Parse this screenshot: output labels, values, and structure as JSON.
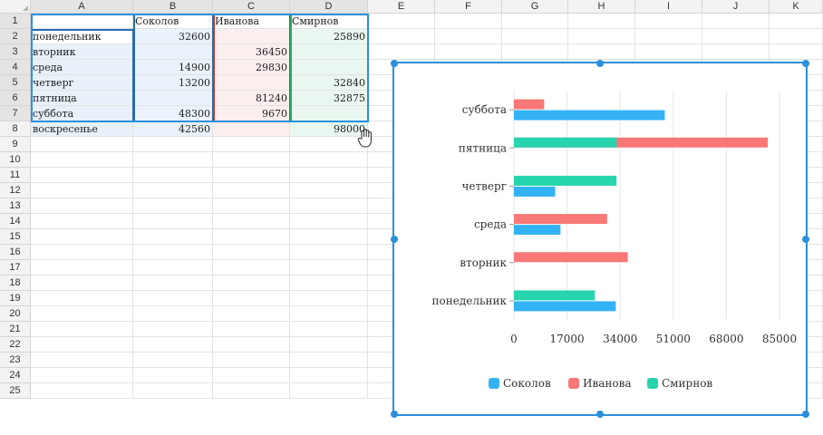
{
  "grid": {
    "columns": [
      "A",
      "B",
      "C",
      "D",
      "E",
      "F",
      "G",
      "H",
      "I",
      "J",
      "K"
    ],
    "rows": [
      "1",
      "2",
      "3",
      "4",
      "5",
      "6",
      "7",
      "8",
      "9",
      "10",
      "11",
      "12",
      "13",
      "14",
      "15",
      "16",
      "17",
      "18",
      "19",
      "20",
      "21",
      "22",
      "23",
      "24",
      "25"
    ],
    "cells": [
      {
        "ref": "B1",
        "value": "Соколов"
      },
      {
        "ref": "C1",
        "value": "Иванова"
      },
      {
        "ref": "D1",
        "value": "Смирнов"
      },
      {
        "ref": "A2",
        "value": "понедельник"
      },
      {
        "ref": "B2",
        "value": "32600"
      },
      {
        "ref": "D2",
        "value": "25890"
      },
      {
        "ref": "A3",
        "value": "вторник"
      },
      {
        "ref": "C3",
        "value": "36450"
      },
      {
        "ref": "A4",
        "value": "среда"
      },
      {
        "ref": "B4",
        "value": "14900"
      },
      {
        "ref": "C4",
        "value": "29830"
      },
      {
        "ref": "A5",
        "value": "четверг"
      },
      {
        "ref": "B5",
        "value": "13200"
      },
      {
        "ref": "D5",
        "value": "32840"
      },
      {
        "ref": "A6",
        "value": "пятница"
      },
      {
        "ref": "C6",
        "value": "81240"
      },
      {
        "ref": "D6",
        "value": "32875"
      },
      {
        "ref": "A7",
        "value": "суббота"
      },
      {
        "ref": "B7",
        "value": "48300"
      },
      {
        "ref": "C7",
        "value": "9670"
      },
      {
        "ref": "A8",
        "value": "воскресенье"
      },
      {
        "ref": "B8",
        "value": "42560"
      },
      {
        "ref": "D8",
        "value": "98000"
      }
    ]
  },
  "colors": {
    "selection": "#2b8fdc",
    "range_a": "#2b6cb0",
    "range_b": "#c0392b",
    "range_c": "#27ae60",
    "fill_a": "#eaf2fb",
    "fill_b": "#fbeeee",
    "fill_c": "#eaf7f1",
    "fill_d": "#e8f1f9"
  },
  "chart_data": {
    "type": "bar",
    "orientation": "horizontal",
    "categories": [
      "понедельник",
      "вторник",
      "среда",
      "четверг",
      "пятница",
      "суббота"
    ],
    "series": [
      {
        "name": "Соколов",
        "color": "#33b3f5",
        "values": [
          32600,
          null,
          14900,
          13200,
          null,
          48300
        ]
      },
      {
        "name": "Иванова",
        "color": "#f87777",
        "values": [
          null,
          36450,
          29830,
          null,
          81240,
          9670
        ]
      },
      {
        "name": "Смирнов",
        "color": "#26d4ad",
        "values": [
          25890,
          null,
          null,
          32840,
          32875,
          null
        ]
      }
    ],
    "x_ticks": [
      0,
      17000,
      34000,
      51000,
      68000,
      85000
    ],
    "xlim": [
      0,
      85000
    ],
    "grid": true,
    "legend_position": "bottom",
    "title": "",
    "xlabel": "",
    "ylabel": ""
  }
}
